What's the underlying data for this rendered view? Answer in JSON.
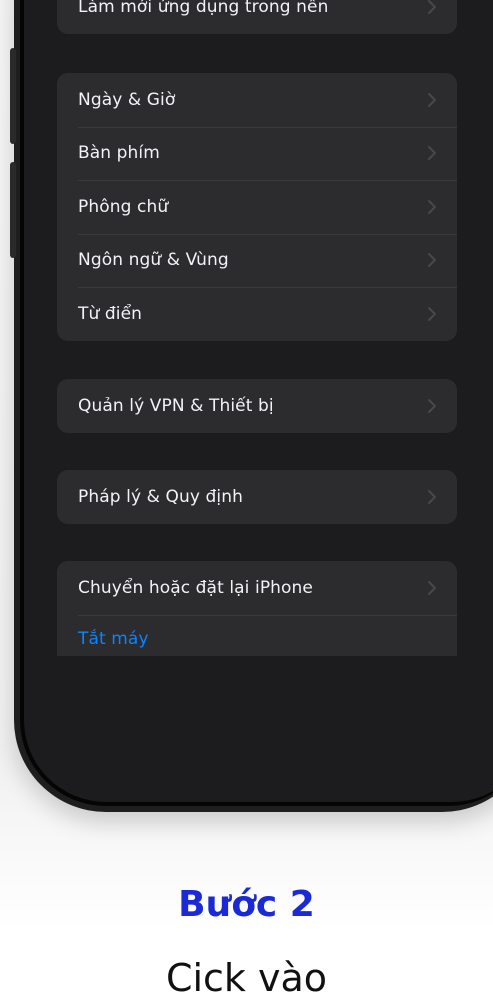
{
  "groups": [
    {
      "rows": [
        {
          "label": "Làm mới ứng dụng trong nền",
          "chevron": true
        }
      ]
    },
    {
      "rows": [
        {
          "label": "Ngày & Giờ",
          "chevron": true
        },
        {
          "label": "Bàn phím",
          "chevron": true
        },
        {
          "label": "Phông chữ",
          "chevron": true
        },
        {
          "label": "Ngôn ngữ & Vùng",
          "chevron": true
        },
        {
          "label": "Từ điển",
          "chevron": true
        }
      ]
    },
    {
      "rows": [
        {
          "label": "Quản lý VPN & Thiết bị",
          "chevron": true
        }
      ]
    },
    {
      "rows": [
        {
          "label": "Pháp lý & Quy định",
          "chevron": true
        }
      ]
    },
    {
      "rows": [
        {
          "label": "Chuyển hoặc đặt lại iPhone",
          "chevron": true
        },
        {
          "label": "Tắt máy",
          "chevron": false
        }
      ]
    }
  ],
  "caption": {
    "step": "Bước 2",
    "text": "Cick vào"
  },
  "colors": {
    "link": "#0a84ff",
    "step_title": "#1a2bd6",
    "cell_background": "#2c2c2e"
  }
}
